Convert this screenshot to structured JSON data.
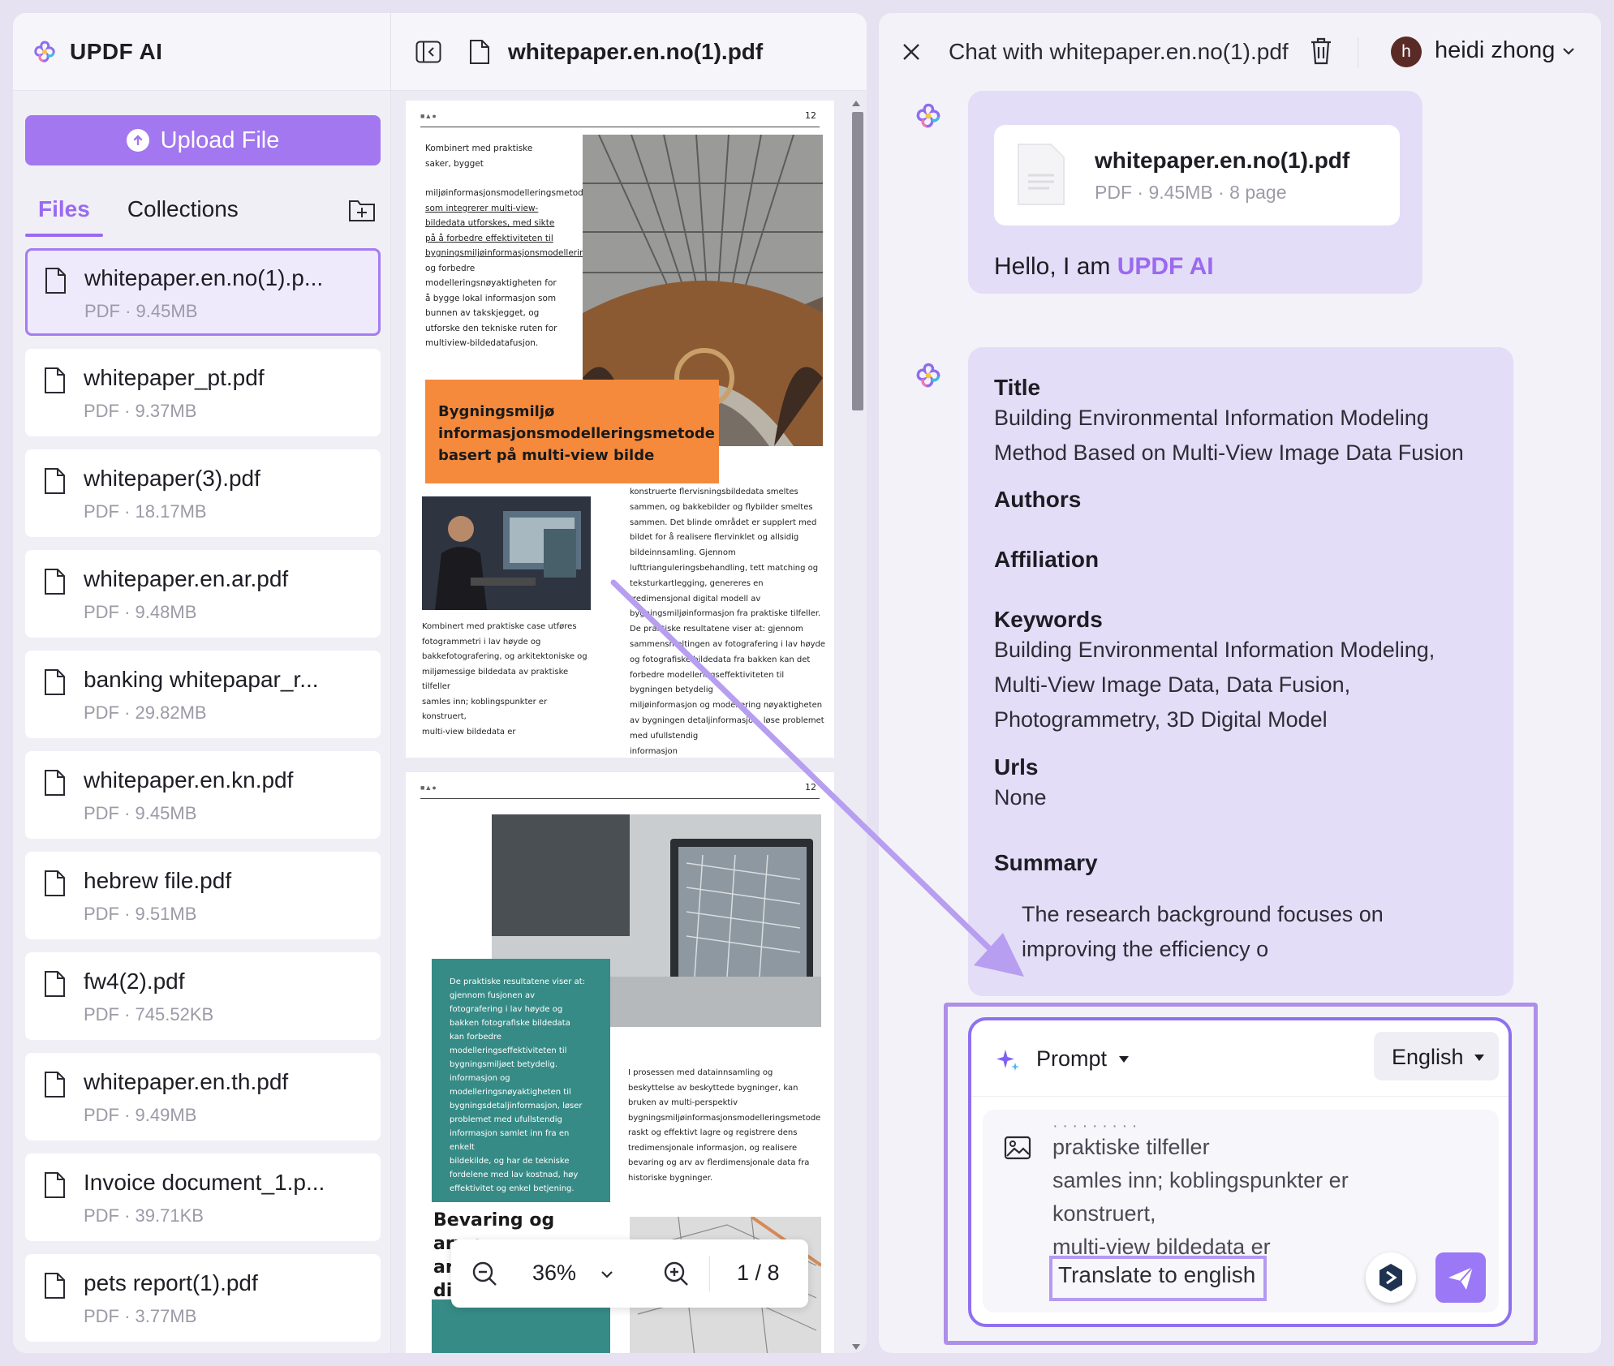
{
  "sidebar": {
    "brand": "UPDF AI",
    "upload_label": "Upload File",
    "tabs": [
      "Files",
      "Collections"
    ],
    "files": [
      {
        "name": "whitepaper.en.no(1).p...",
        "meta": "PDF · 9.45MB",
        "selected": true
      },
      {
        "name": "whitepaper_pt.pdf",
        "meta": "PDF · 9.37MB"
      },
      {
        "name": "whitepaper(3).pdf",
        "meta": "PDF · 18.17MB"
      },
      {
        "name": "whitepaper.en.ar.pdf",
        "meta": "PDF · 9.48MB"
      },
      {
        "name": "banking whitepapar_r...",
        "meta": "PDF · 29.82MB"
      },
      {
        "name": "whitepaper.en.kn.pdf",
        "meta": "PDF · 9.45MB"
      },
      {
        "name": "hebrew file.pdf",
        "meta": "PDF · 9.51MB"
      },
      {
        "name": "fw4(2).pdf",
        "meta": "PDF · 745.52KB"
      },
      {
        "name": "whitepaper.en.th.pdf",
        "meta": "PDF · 9.49MB"
      },
      {
        "name": "Invoice document_1.p...",
        "meta": "PDF · 39.71KB"
      },
      {
        "name": "pets report(1).pdf",
        "meta": "PDF · 3.77MB"
      }
    ]
  },
  "viewer": {
    "title": "whitepaper.en.no(1).pdf",
    "zoom": "36%",
    "page_indicator": "1 / 8",
    "page1": {
      "page_number": "12",
      "intro_text": [
        "Kombinert med praktiske",
        "saker, bygget",
        "",
        "miljøinformasjonsmodelleringsmetode",
        "som integrerer multi-view-",
        "bildedata utforskes, med sikte",
        "på å forbedre effektiviteten til",
        "bygningsmiljøinformasjonsmodellering",
        "og forbedre",
        "modelleringsnøyaktigheten for",
        "å bygge lokal informasjon som",
        "bunnen av takskjegget, og",
        "utforske den tekniske ruten for",
        "multiview-bildedatafusjon."
      ],
      "heading": [
        "Bygningsmiljø",
        "informasjonsmodelleringsmetode",
        "basert på multi-view bilde"
      ],
      "caption": [
        "Kombinert med praktiske case utføres",
        "fotogrammetri i lav høyde og",
        "bakkefotografering, og arkitektoniske og",
        "miljømessige bildedata av praktiske tilfeller",
        "samles inn; koblingspunkter er konstruert,",
        "multi-view bildedata er"
      ],
      "right_col": [
        "konstruerte flervisningsbildedata smeltes",
        "sammen, og bakkebilder og flybilder smeltes",
        "sammen. Det blinde området er supplert med",
        "bildet for å realisere flervinklet og allsidig",
        "bildeinnsamling. Gjennom",
        "lufttrianguleringsbehandling, tett matching og",
        "teksturkartlegging, genereres en",
        "tredimensjonal digital modell av",
        "bygningsmiljøinformasjon fra praktiske tilfeller.",
        "De praktiske resultatene viser at: gjennom",
        "sammensmeltingen av fotografering i lav høyde",
        "og fotografiske bildedata fra bakken kan det",
        "forbedre modelleringseffektiviteten til",
        "bygningen betydelig",
        "miljøinformasjon og modellering nøyaktigheten",
        "av bygningen detaljinformasjon, løse problemet",
        "med ufullstendig",
        "informasjon"
      ]
    },
    "page2": {
      "page_number": "12",
      "teal_text": [
        "De praktiske resultatene viser at:",
        "gjennom fusjonen av",
        "fotografering i lav høyde og",
        "bakken fotografiske bildedata",
        "kan forbedre",
        "modelleringseffektiviteten til",
        "bygningsmiljøet betydelig.",
        "informasjon og",
        "modelleringsnøyaktigheten til",
        "bygningsdetaljinformasjon, løser",
        "problemet med ufullstendig",
        "informasjon samlet inn fra en enkelt",
        "bildekilde, og har de tekniske",
        "fordelene med lav kostnad, høy",
        "effektivitet og enkel betjening."
      ],
      "right_text": [
        "I prosessen med datainnsamling og",
        "beskyttelse av beskyttede bygninger, kan",
        "bruken av multi-perspektiv",
        "bygningsmiljøinformasjonsmodelleringsmetode",
        "raskt og effektivt lagre og registrere dens",
        "tredimensjonale informasjon, og realisere",
        "bevaring og arv av flerdimensjonale data fra",
        "historiske bygninger."
      ],
      "heading": [
        "Bevaring og",
        "arv av",
        "ar",
        "di"
      ]
    }
  },
  "chat": {
    "title": "Chat with whitepaper.en.no(1).pdf",
    "user": {
      "initial": "h",
      "name": "heidi zhong"
    },
    "file_card": {
      "name": "whitepaper.en.no(1).pdf",
      "meta": "PDF · 9.45MB · 8 page"
    },
    "greeting_prefix": "Hello, I am ",
    "greeting_brand": "UPDF AI",
    "response": {
      "title_h": "Title",
      "title_v": [
        "Building Environmental Information Modeling",
        "Method Based on Multi-View Image Data Fusion"
      ],
      "authors_h": "Authors",
      "affiliation_h": "Affiliation",
      "keywords_h": "Keywords",
      "keywords_v": [
        "Building Environmental Information Modeling,",
        "Multi-View Image Data, Data Fusion,",
        "Photogrammetry, 3D Digital Model"
      ],
      "urls_h": "Urls",
      "urls_v": "None",
      "summary_h": "Summary",
      "summary_v": [
        "The research background focuses on",
        "improving the efficiency o"
      ]
    },
    "input": {
      "mode": "Prompt",
      "language": "English",
      "lines": [
        "praktiske tilfeller",
        "samles inn; koblingspunkter er",
        "konstruert,",
        "multi-view bildedata er"
      ],
      "typed": "Translate to english"
    }
  },
  "colors": {
    "accent": "#9a6af0",
    "upload": "#a277f0",
    "orange": "#f58a3d",
    "teal": "#378b86"
  }
}
